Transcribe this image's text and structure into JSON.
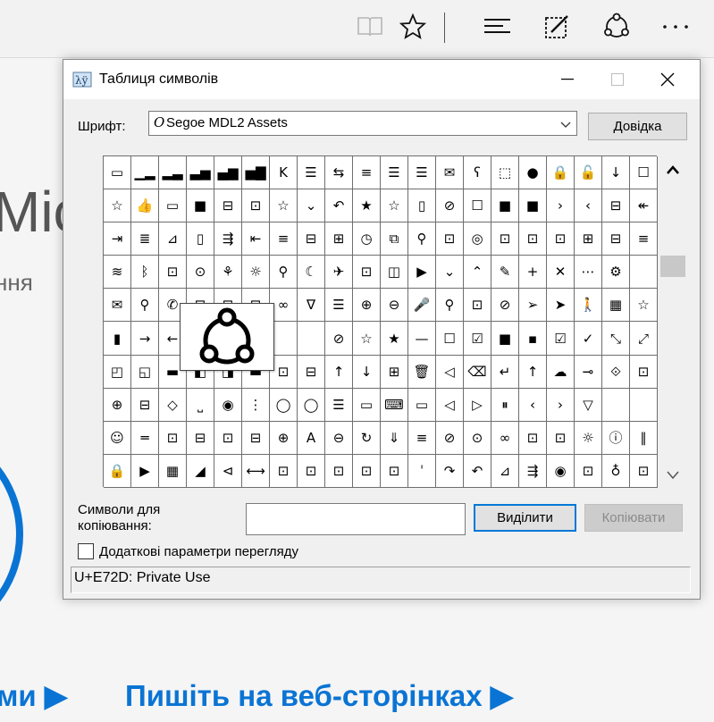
{
  "dialog": {
    "title": "Таблиця символів",
    "font_label": "Шрифт:",
    "font_value": "Segoe MDL2 Assets",
    "font_icon": "O",
    "help_button": "Довідка",
    "copy_label": "Символи для копіювання:",
    "copy_value": "",
    "select_button": "Виділити",
    "copy_button": "Копіювати",
    "advanced_label": "Додаткові параметри перегляду",
    "status": "U+E72D: Private Use",
    "grid": [
      [
        "▭",
        "▁▂",
        "▂▃",
        "▃▅",
        "▄▆",
        "▅▇",
        "K",
        "☰",
        "⇆",
        "≡",
        "☰",
        "☰",
        "✉",
        "ʕ",
        "⬚",
        "●",
        "🔒",
        "🔓",
        "↓",
        "☐"
      ],
      [
        "☆",
        "👍",
        "▭",
        "■",
        "⊟",
        "⊡",
        "☆",
        "⌄",
        "↶",
        "★",
        "☆",
        "▯",
        "⊘",
        "☐",
        "■",
        "■",
        "›",
        "‹",
        "⊟",
        "↞"
      ],
      [
        "⇥",
        "≣",
        "⊿",
        "▯",
        "⇶",
        "⇤",
        "≡",
        "⊟",
        "⊞",
        "◷",
        "⧉",
        "⚲",
        "⊡",
        "◎",
        "⊡",
        "⊡",
        "⊡",
        "⊞",
        "⊟",
        "≡"
      ],
      [
        "≋",
        "ᛒ",
        "⊡",
        "⊙",
        "⚘",
        "☼",
        "⚲",
        "☾",
        "✈",
        "⊡",
        "◫",
        "▶",
        "⌄",
        "⌃",
        "✎",
        "+",
        "✕",
        "⋯",
        "⚙",
        ""
      ],
      [
        "✉",
        "⚲",
        "✆",
        "⊡",
        "⊡",
        "⊡",
        "∞",
        "∇",
        "☰",
        "⊕",
        "⊖",
        "🎤",
        "⚲",
        "⊡",
        "⊘",
        "➢",
        "➤",
        "🚶",
        "▦",
        "☆"
      ],
      [
        "▮",
        "→",
        "←",
        "",
        "",
        "",
        "",
        "",
        "⊘",
        "☆",
        "★",
        "—",
        "☐",
        "☑",
        "■",
        "▪",
        "☑",
        "✓",
        "⤡",
        "⤢"
      ],
      [
        "◰",
        "◱",
        "▬",
        "◧",
        "◨",
        "▬",
        "⊡",
        "⊟",
        "↑",
        "↓",
        "⊞",
        "🗑",
        "◁",
        "⌫",
        "↵",
        "↑",
        "☁",
        "⊸",
        "⟐",
        "⊡"
      ],
      [
        "⊕",
        "⊟",
        "◇",
        "⎵",
        "◉",
        "⋮",
        "◯",
        "◯",
        "☰",
        "▭",
        "⌨",
        "▭",
        "◁",
        "▷",
        "⏸",
        "‹",
        "›",
        "▽",
        "",
        ""
      ],
      [
        "☺",
        "═",
        "⊡",
        "⊟",
        "⊡",
        "⊟",
        "⊕",
        "A",
        "⊖",
        "↻",
        "⇓",
        "≡",
        "⊘",
        "⊙",
        "∞",
        "⊡",
        "⊡",
        "☼",
        "ⓘ",
        "∥"
      ],
      [
        "🔒",
        "▶",
        "▦",
        "◢",
        "⊲",
        "⟷",
        "⊡",
        "⊡",
        "⊡",
        "⊡",
        "⊡",
        "ˈ",
        "↷",
        "↶",
        "⊿",
        "⇶",
        "◉",
        "⊡",
        "♁",
        "⊡"
      ]
    ]
  },
  "background": {
    "word_fragment": "Micr",
    "word_fragment_2": "ння",
    "link_left": "ми ▶",
    "link_right": "Пишіть на веб-сторінках ▶"
  },
  "icons": {
    "reading_view": "book-icon",
    "favorites": "star-icon",
    "hub": "hub-icon",
    "notes": "pen-square-icon",
    "share": "share-icon",
    "more": "more-icon",
    "magnified": "share-icon"
  },
  "colors": {
    "accent": "#0078d7",
    "background_link": "#0a74d4"
  }
}
